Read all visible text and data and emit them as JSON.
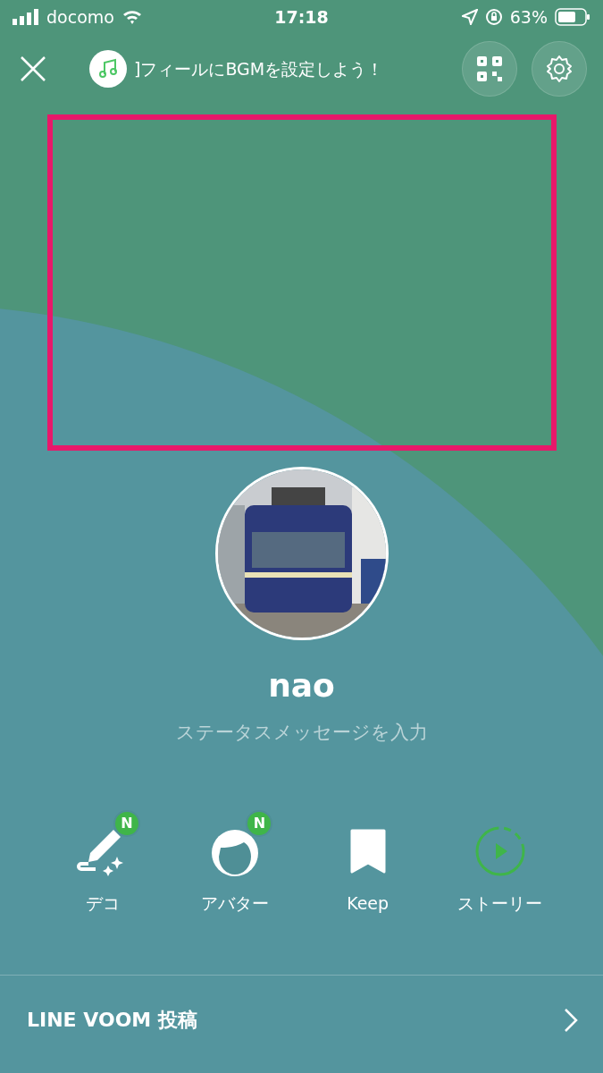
{
  "status_bar": {
    "carrier": "docomo",
    "time": "17:18",
    "battery": "63%"
  },
  "header": {
    "banner_text": "]フィールにBGMを設定しよう！"
  },
  "profile": {
    "name": "nao",
    "status_placeholder": "ステータスメッセージを入力"
  },
  "actions": [
    {
      "kind": "deco",
      "label": "デコ",
      "badge": "N"
    },
    {
      "kind": "avatar",
      "label": "アバター",
      "badge": "N"
    },
    {
      "kind": "keep",
      "label": "Keep"
    },
    {
      "kind": "story",
      "label": "ストーリー"
    }
  ],
  "footer": {
    "label": "LINE VOOM 投稿"
  }
}
